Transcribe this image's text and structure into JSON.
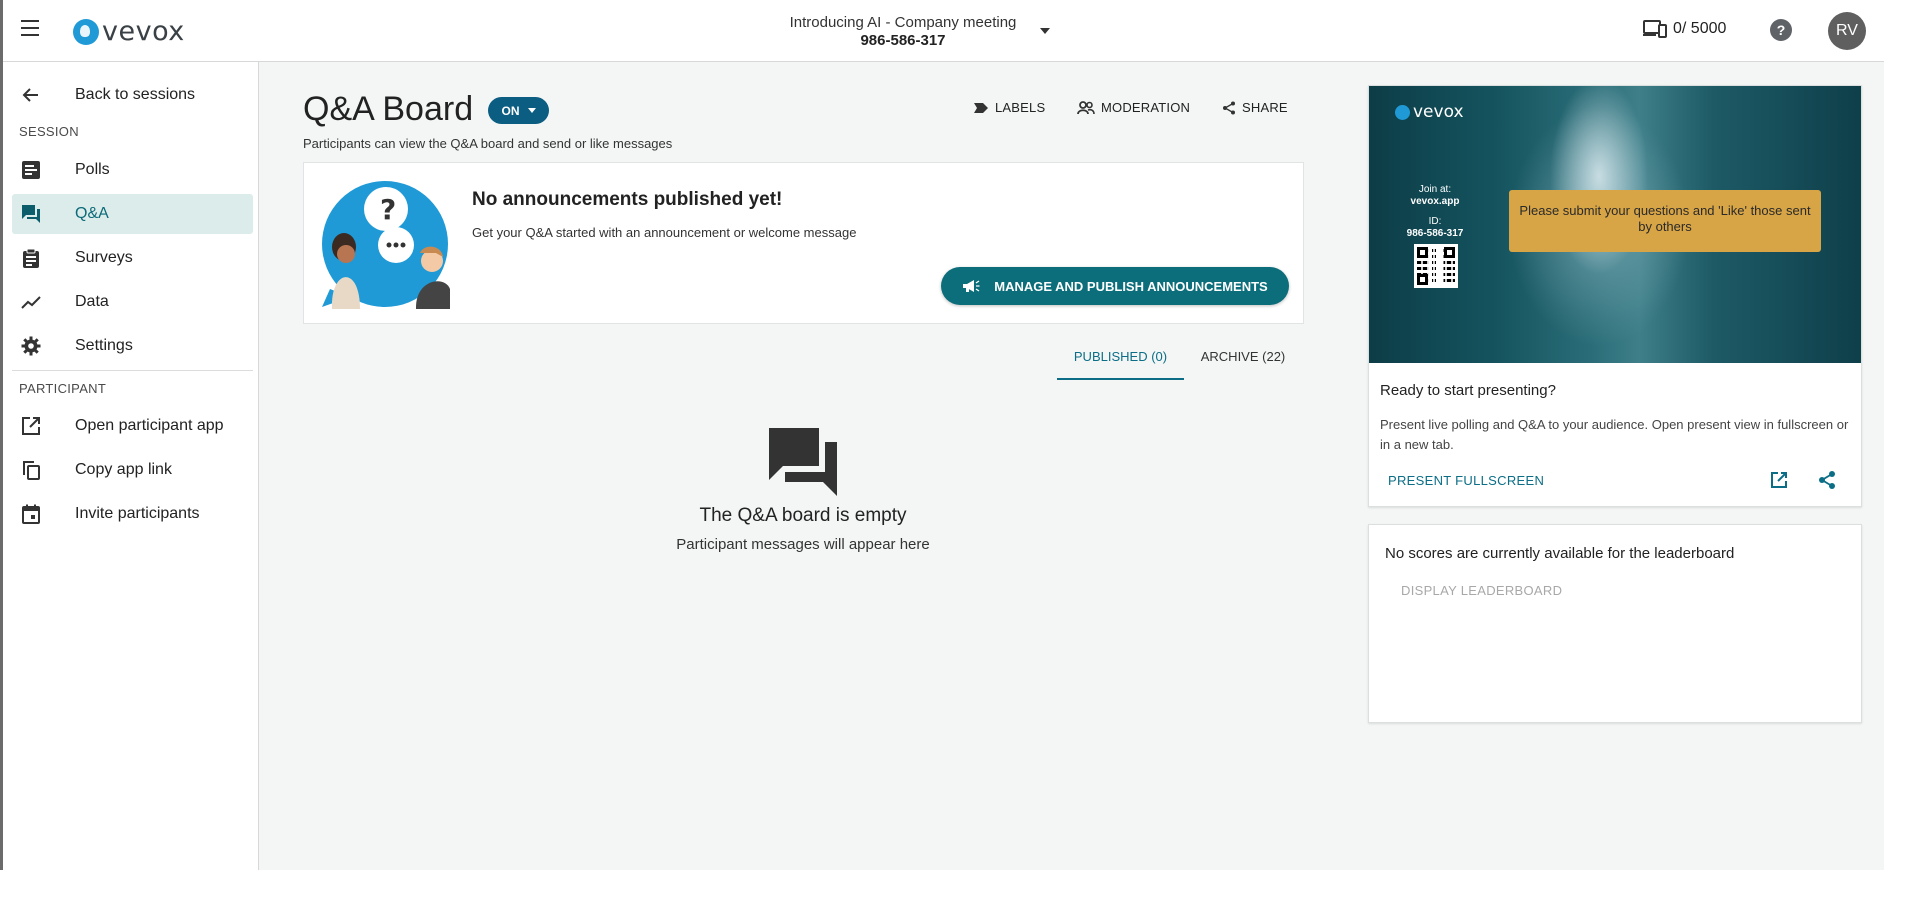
{
  "header": {
    "brand": "vevox",
    "session_title": "Introducing AI - Company meeting",
    "session_id": "986-586-317",
    "counter": "0/ 5000",
    "help": "?",
    "avatar_initials": "RV"
  },
  "sidebar": {
    "back_label": "Back to sessions",
    "session_section": "SESSION",
    "session_items": [
      {
        "label": "Polls",
        "icon": "poll-icon"
      },
      {
        "label": "Q&A",
        "icon": "forum-icon",
        "active": true
      },
      {
        "label": "Surveys",
        "icon": "clipboard-icon"
      },
      {
        "label": "Data",
        "icon": "trending-icon"
      },
      {
        "label": "Settings",
        "icon": "gear-icon"
      }
    ],
    "participant_section": "PARTICIPANT",
    "participant_items": [
      {
        "label": "Open participant app",
        "icon": "open-in-new-icon"
      },
      {
        "label": "Copy app link",
        "icon": "copy-icon"
      },
      {
        "label": "Invite participants",
        "icon": "calendar-icon"
      }
    ]
  },
  "main": {
    "title": "Q&A Board",
    "toggle_label": "ON",
    "subtitle": "Participants can view the Q&A board and send or like messages",
    "actions": {
      "labels": "LABELS",
      "moderation": "MODERATION",
      "share": "SHARE"
    },
    "announcement": {
      "title": "No announcements published yet!",
      "description": "Get your Q&A started with an announcement or welcome message",
      "button": "MANAGE AND PUBLISH ANNOUNCEMENTS"
    },
    "tabs": [
      {
        "label": "PUBLISHED (0)",
        "active": true
      },
      {
        "label": "ARCHIVE (22)",
        "active": false
      }
    ],
    "empty": {
      "title": "The Q&A board is empty",
      "description": "Participant messages will appear here"
    }
  },
  "present": {
    "preview_brand": "vevox",
    "join_at_label": "Join at:",
    "join_url": "vevox.app",
    "id_label": "ID:",
    "id_value": "986-586-317",
    "message": "Please submit your questions and 'Like' those sent by others",
    "ready_title": "Ready to start presenting?",
    "ready_description": "Present live polling and Q&A to your audience. Open present view in fullscreen or in a new tab.",
    "present_button": "PRESENT FULLSCREEN"
  },
  "leaderboard": {
    "title": "No scores are currently available for the leaderboard",
    "button": "DISPLAY LEADERBOARD"
  },
  "colors": {
    "accent": "#0b6e7a",
    "toggle": "#0b5d82",
    "active_nav_bg": "#dbeceb",
    "message_box": "#d8a546"
  }
}
